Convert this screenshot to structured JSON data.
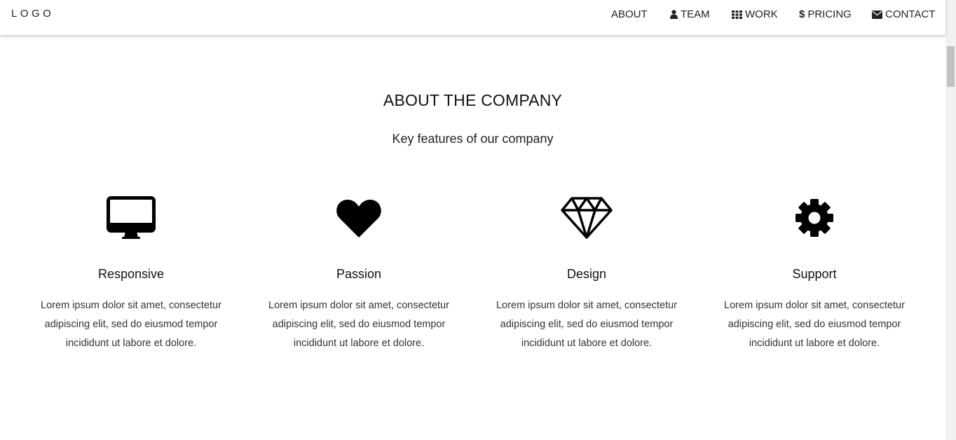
{
  "navbar": {
    "logo": "LOGO",
    "items": [
      {
        "label": "ABOUT",
        "icon": ""
      },
      {
        "label": "TEAM",
        "icon": "user-icon"
      },
      {
        "label": "WORK",
        "icon": "grid-icon"
      },
      {
        "label": "PRICING",
        "icon": "dollar-icon"
      },
      {
        "label": "CONTACT",
        "icon": "envelope-icon"
      }
    ]
  },
  "about": {
    "title": "ABOUT THE COMPANY",
    "subtitle": "Key features of our company",
    "features": [
      {
        "icon": "desktop-icon",
        "title": "Responsive",
        "text": "Lorem ipsum dolor sit amet, consectetur adipiscing elit, sed do eiusmod tempor incididunt ut labore et dolore."
      },
      {
        "icon": "heart-icon",
        "title": "Passion",
        "text": "Lorem ipsum dolor sit amet, consectetur adipiscing elit, sed do eiusmod tempor incididunt ut labore et dolore."
      },
      {
        "icon": "diamond-icon",
        "title": "Design",
        "text": "Lorem ipsum dolor sit amet, consectetur adipiscing elit, sed do eiusmod tempor incididunt ut labore et dolore."
      },
      {
        "icon": "gear-icon",
        "title": "Support",
        "text": "Lorem ipsum dolor sit amet, consectetur adipiscing elit, sed do eiusmod tempor incididunt ut labore et dolore."
      }
    ]
  }
}
